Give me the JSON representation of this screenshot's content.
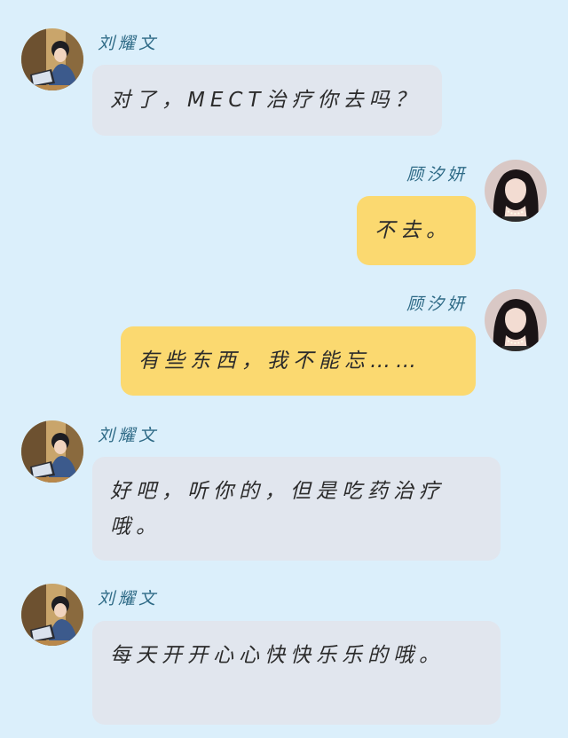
{
  "colors": {
    "background": "#dbeffb",
    "incoming_bubble": "#e1e6ee",
    "outgoing_bubble": "#fbd970",
    "name_text": "#2e6a86"
  },
  "messages": [
    {
      "side": "left",
      "name": "刘耀文",
      "text": "对了，MECT治疗你去吗？",
      "avatar": "boy-with-laptop-avatar"
    },
    {
      "side": "right",
      "name": "顾汐妍",
      "text": "不去。",
      "avatar": "girl-portrait-avatar"
    },
    {
      "side": "right",
      "name": "顾汐妍",
      "text": "有些东西，我不能忘……",
      "avatar": "girl-portrait-avatar"
    },
    {
      "side": "left",
      "name": "刘耀文",
      "text": "好吧，听你的，但是吃药治疗哦。",
      "avatar": "boy-with-laptop-avatar"
    },
    {
      "side": "left",
      "name": "刘耀文",
      "text": "每天开开心心快快乐乐的哦。",
      "avatar": "boy-with-laptop-avatar"
    }
  ]
}
